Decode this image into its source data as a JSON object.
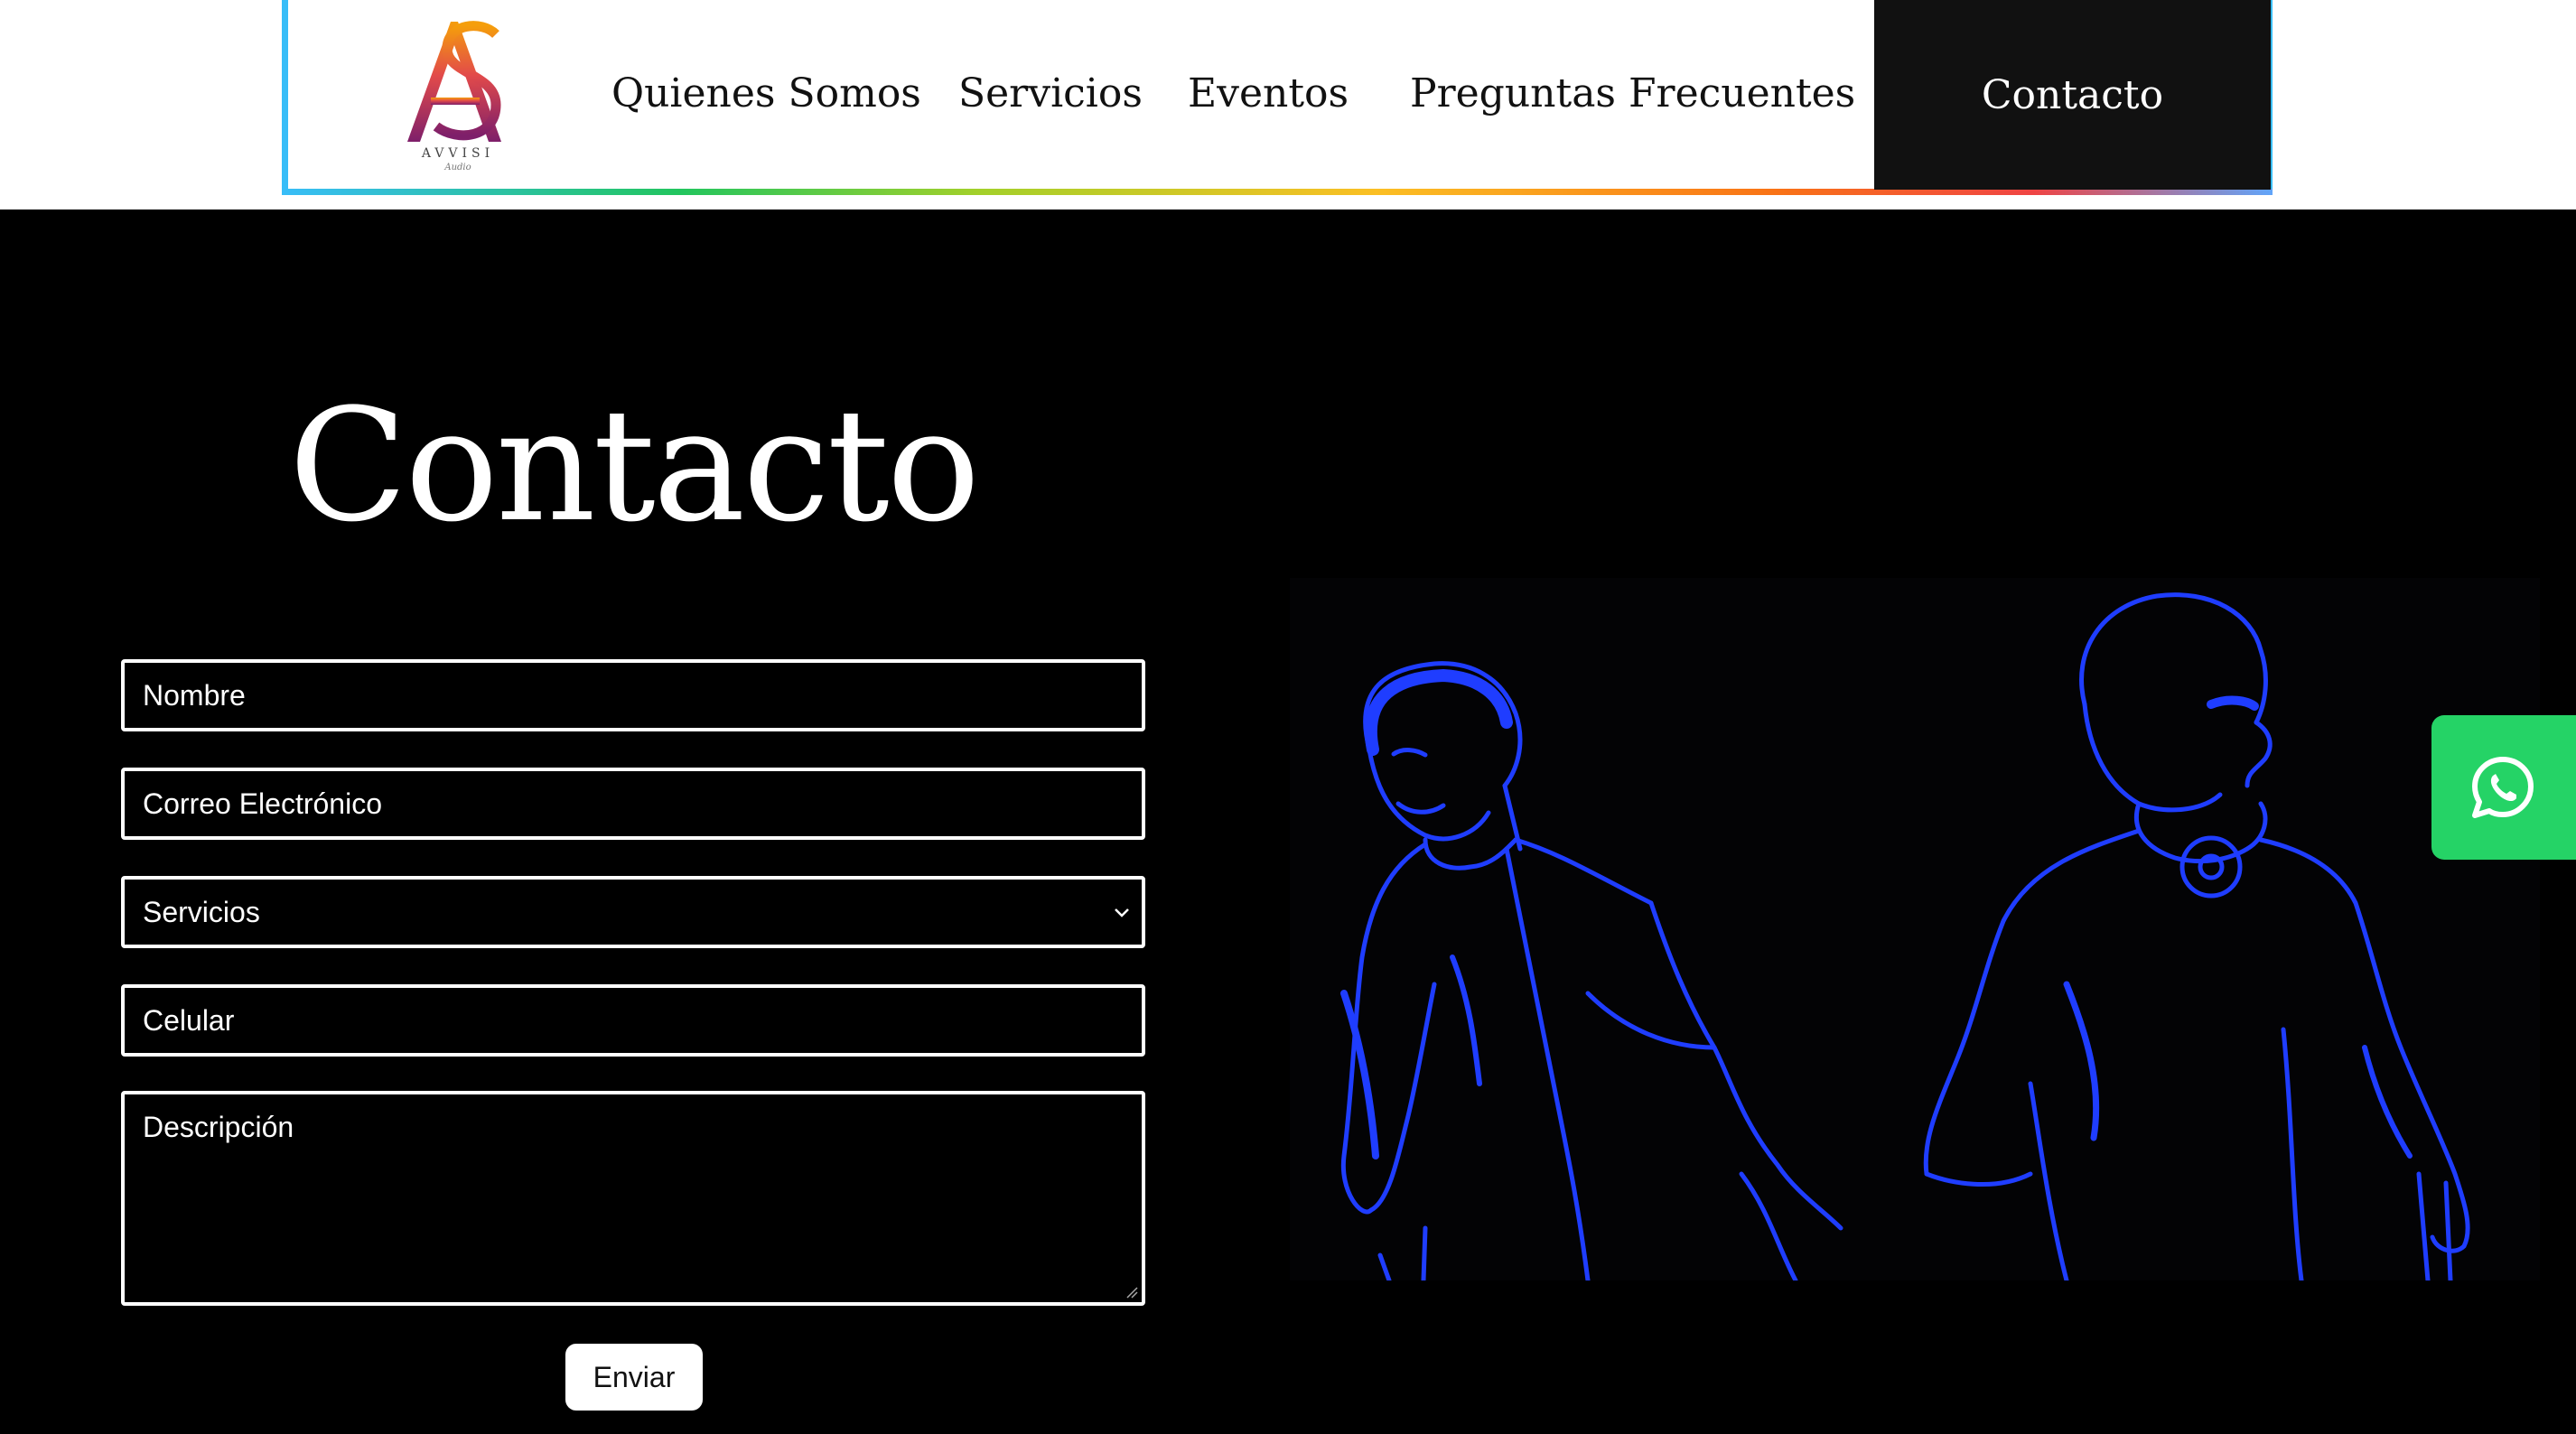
{
  "header": {
    "logo": {
      "brand": "AVVISI",
      "sub": "Audio",
      "monogram": "AS"
    },
    "nav": {
      "quienes_somos": "Quienes Somos",
      "servicios": "Servicios",
      "eventos": "Eventos",
      "preguntas_frecuentes": "Preguntas Frecuentes",
      "contacto": "Contacto"
    }
  },
  "main": {
    "title": "Contacto",
    "form": {
      "nombre_placeholder": "Nombre",
      "correo_placeholder": "Correo Electrónico",
      "servicios_selected": "Servicios",
      "celular_placeholder": "Celular",
      "descripcion_placeholder": "Descripción",
      "submit_label": "Enviar"
    }
  },
  "floating": {
    "whatsapp_icon": "whatsapp-icon"
  },
  "colors": {
    "nav_border": "#38bdf8",
    "line_art": "#1f3dff",
    "whatsapp": "#25d366",
    "contacto_bg": "#111111"
  }
}
